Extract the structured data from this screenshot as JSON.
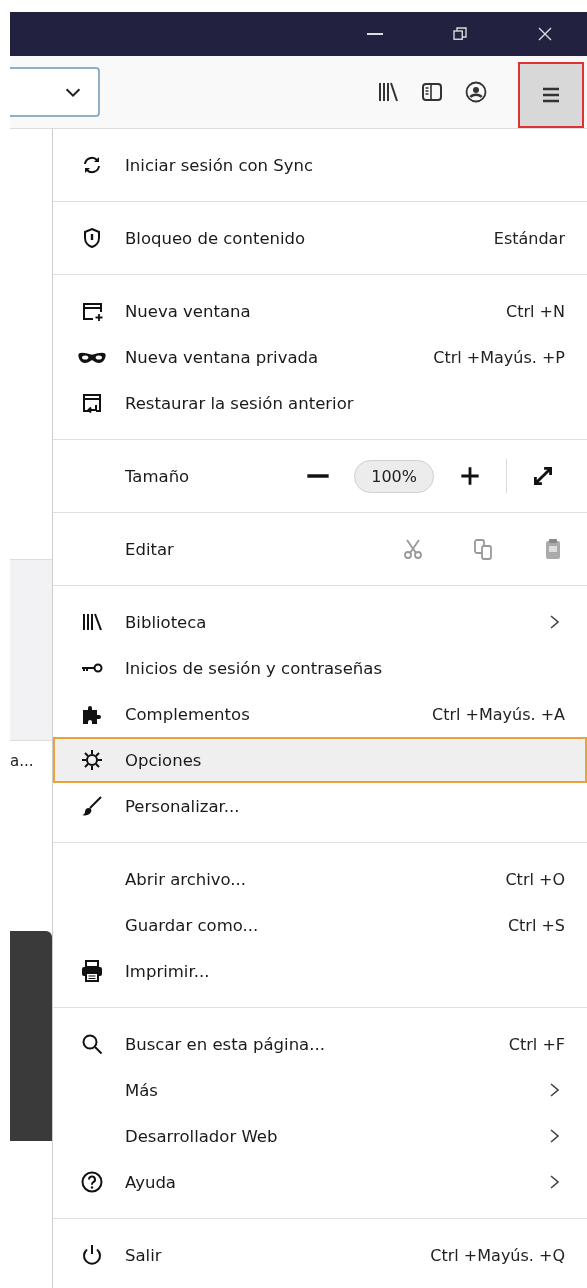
{
  "toolbar": {
    "menu_button": {
      "open": true
    }
  },
  "page": {
    "text": "a..."
  },
  "menu": {
    "sections": [
      {
        "items": [
          {
            "kind": "item",
            "label": "Iniciar sesión con Sync",
            "selected": false
          }
        ]
      },
      {
        "items": [
          {
            "kind": "item",
            "label": "Bloqueo de contenido",
            "value": "Estándar",
            "selected": false
          }
        ]
      },
      {
        "items": [
          {
            "kind": "item",
            "label": "Nueva ventana",
            "shortcut": "Ctrl +N",
            "selected": false
          },
          {
            "kind": "item",
            "label": "Nueva ventana privada",
            "shortcut": "Ctrl +Mayús. +P",
            "selected": false
          },
          {
            "kind": "item",
            "label": "Restaurar la sesión anterior",
            "selected": false
          }
        ]
      },
      {
        "items": [
          {
            "kind": "zoom",
            "label": "Tamaño",
            "value": "100%",
            "selected": false
          }
        ]
      },
      {
        "items": [
          {
            "kind": "edit",
            "label": "Editar",
            "selected": false
          }
        ]
      },
      {
        "items": [
          {
            "kind": "item",
            "label": "Biblioteca",
            "submenu": true,
            "selected": false
          },
          {
            "kind": "item",
            "label": "Inicios de sesión y contraseñas",
            "selected": false
          },
          {
            "kind": "item",
            "label": "Complementos",
            "shortcut": "Ctrl +Mayús. +A",
            "selected": false
          },
          {
            "kind": "item",
            "label": "Opciones",
            "selected": true
          },
          {
            "kind": "item",
            "label": "Personalizar...",
            "selected": false
          }
        ]
      },
      {
        "items": [
          {
            "kind": "item",
            "label": "Abrir archivo...",
            "shortcut": "Ctrl +O",
            "selected": false
          },
          {
            "kind": "item",
            "label": "Guardar como...",
            "shortcut": "Ctrl +S",
            "selected": false
          },
          {
            "kind": "item",
            "label": "Imprimir...",
            "selected": false
          }
        ]
      },
      {
        "items": [
          {
            "kind": "item",
            "label": "Buscar en esta página...",
            "shortcut": "Ctrl +F",
            "selected": false
          },
          {
            "kind": "item",
            "label": "Más",
            "submenu": true,
            "selected": false
          },
          {
            "kind": "item",
            "label": "Desarrollador Web",
            "submenu": true,
            "selected": false
          },
          {
            "kind": "item",
            "label": "Ayuda",
            "submenu": true,
            "selected": false
          }
        ]
      },
      {
        "items": [
          {
            "kind": "item",
            "label": "Salir",
            "shortcut": "Ctrl +Mayús. +Q",
            "selected": false
          }
        ]
      }
    ]
  }
}
